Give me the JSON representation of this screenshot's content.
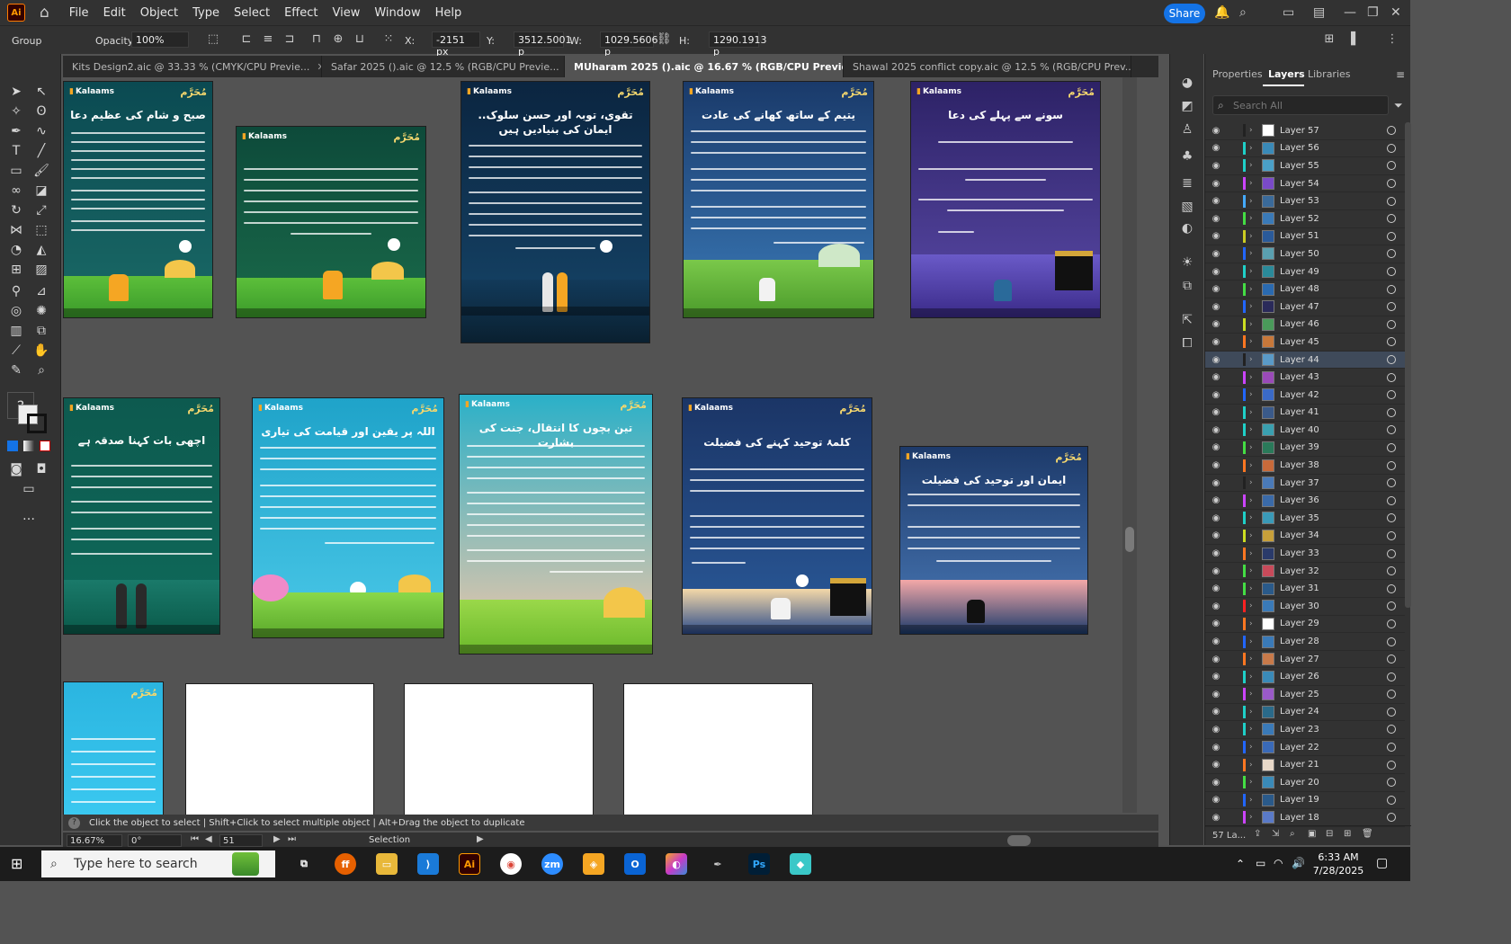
{
  "app": {
    "logo": "Ai",
    "menu": [
      "File",
      "Edit",
      "Object",
      "Type",
      "Select",
      "Effect",
      "View",
      "Window",
      "Help"
    ],
    "share_label": "Share"
  },
  "control_bar": {
    "selection_label": "Group",
    "opacity_label": "Opacity:",
    "opacity_value": "100%",
    "x_label": "X:",
    "x_value": "-2151 px",
    "y_label": "Y:",
    "y_value": "3512.5001 p",
    "w_label": "W:",
    "w_value": "1029.5606 p",
    "h_label": "H:",
    "h_value": "1290.1913 p"
  },
  "tabs": [
    {
      "label": "Kits Design2.aic @ 33.33 % (CMYK/CPU Previe...",
      "active": false
    },
    {
      "label": "Safar 2025 ().aic @ 12.5 % (RGB/CPU Previe...",
      "active": false
    },
    {
      "label": "MUharam 2025 ().aic @ 16.67 % (RGB/CPU Preview)",
      "active": true
    },
    {
      "label": "Shawal 2025 conflict copy.aic @ 12.5 % (RGB/CPU Prev...",
      "active": false
    }
  ],
  "artboard_brand": "Kalaams",
  "artboard_logo": "مُحَرَّم",
  "artboards": [
    {
      "title": "صبح و شام کی عظیم دعا",
      "bg": "#0b4a52"
    },
    {
      "title": "",
      "bg": "#0d5a3f"
    },
    {
      "title": "تقوی، توبہ اور حسن سلوک.. ایمان کی بنیادیں ہیں",
      "bg": "#0f2d4a"
    },
    {
      "title": "یتیم کے ساتھ کھانے کی عادت",
      "bg": "#1c4a7a"
    },
    {
      "title": "سونے سے پہلے کی دعا",
      "bg": "#3b2d7a"
    },
    {
      "title": "اچھی بات کہنا صدقہ ہے",
      "bg": "#0d5a4f"
    },
    {
      "title": "اللہ پر یقین اور قیامت کی تیاری",
      "bg": "#1fa3c9"
    },
    {
      "title": "تین بچوں کا انتقال، جنت کی بشارت",
      "bg": "#33b5c4"
    },
    {
      "title": "کلمۂ توحید کہنے کی فضیلت",
      "bg": "#1b3566"
    },
    {
      "title": "ایمان اور توحید کی فضیلت",
      "bg": "#1d3a6a"
    },
    {
      "title": "",
      "bg": "#2bb5e0"
    }
  ],
  "layers_panel": {
    "tabs": [
      "Properties",
      "Layers",
      "Libraries"
    ],
    "search_placeholder": "Search All",
    "layers": [
      {
        "name": "Layer 57",
        "color": "#222222",
        "thumb": "#ffffff"
      },
      {
        "name": "Layer 56",
        "color": "#1fd0c8",
        "thumb": "#3a8ab8"
      },
      {
        "name": "Layer 55",
        "color": "#1fd0c8",
        "thumb": "#4aa0c8"
      },
      {
        "name": "Layer 54",
        "color": "#cc44ff",
        "thumb": "#7a4ac8"
      },
      {
        "name": "Layer 53",
        "color": "#44aaff",
        "thumb": "#3a6a9a"
      },
      {
        "name": "Layer 52",
        "color": "#44dd44",
        "thumb": "#3a7ab8"
      },
      {
        "name": "Layer 51",
        "color": "#cccc22",
        "thumb": "#2a5a9a"
      },
      {
        "name": "Layer 50",
        "color": "#2266ff",
        "thumb": "#5aa0b0"
      },
      {
        "name": "Layer 49",
        "color": "#1fd0c8",
        "thumb": "#2a8a9a"
      },
      {
        "name": "Layer 48",
        "color": "#44dd44",
        "thumb": "#2a6ab0"
      },
      {
        "name": "Layer 47",
        "color": "#2266ff",
        "thumb": "#2a2a5a"
      },
      {
        "name": "Layer 46",
        "color": "#ccdd22",
        "thumb": "#4a9a5a"
      },
      {
        "name": "Layer 45",
        "color": "#ff7722",
        "thumb": "#c8783a"
      },
      {
        "name": "Layer 44",
        "color": "#222222",
        "thumb": "#5a9ac8",
        "selected": true
      },
      {
        "name": "Layer 43",
        "color": "#cc44ff",
        "thumb": "#9a4ab8"
      },
      {
        "name": "Layer 42",
        "color": "#2266ff",
        "thumb": "#3a6ac8"
      },
      {
        "name": "Layer 41",
        "color": "#1fd0c8",
        "thumb": "#3a5a8a"
      },
      {
        "name": "Layer 40",
        "color": "#1fd0c8",
        "thumb": "#3aa0b0"
      },
      {
        "name": "Layer 39",
        "color": "#44dd44",
        "thumb": "#2a7a5a"
      },
      {
        "name": "Layer 38",
        "color": "#ff7722",
        "thumb": "#c86a3a"
      },
      {
        "name": "Layer 37",
        "color": "#222222",
        "thumb": "#4a7ab8"
      },
      {
        "name": "Layer 36",
        "color": "#cc44ff",
        "thumb": "#3a6aa8"
      },
      {
        "name": "Layer 35",
        "color": "#1fd0c8",
        "thumb": "#3a9ab8"
      },
      {
        "name": "Layer 34",
        "color": "#ccdd22",
        "thumb": "#c8a03a"
      },
      {
        "name": "Layer 33",
        "color": "#ff7722",
        "thumb": "#2a3a6a"
      },
      {
        "name": "Layer 32",
        "color": "#44dd44",
        "thumb": "#c84a5a"
      },
      {
        "name": "Layer 31",
        "color": "#44dd44",
        "thumb": "#2a5a8a"
      },
      {
        "name": "Layer 30",
        "color": "#ff2222",
        "thumb": "#3a7ab8"
      },
      {
        "name": "Layer 29",
        "color": "#ff7722",
        "thumb": "#ffffff"
      },
      {
        "name": "Layer 28",
        "color": "#2266ff",
        "thumb": "#3a7ab8"
      },
      {
        "name": "Layer 27",
        "color": "#ff7722",
        "thumb": "#c87a4a"
      },
      {
        "name": "Layer 26",
        "color": "#1fd0c8",
        "thumb": "#3a8ab8"
      },
      {
        "name": "Layer 25",
        "color": "#cc44ff",
        "thumb": "#9a5ac8"
      },
      {
        "name": "Layer 24",
        "color": "#1fd0c8",
        "thumb": "#2a6a8a"
      },
      {
        "name": "Layer 23",
        "color": "#1fd0c8",
        "thumb": "#3a7ab8"
      },
      {
        "name": "Layer 22",
        "color": "#2266ff",
        "thumb": "#3a6ab8"
      },
      {
        "name": "Layer 21",
        "color": "#ff7722",
        "thumb": "#e8d8c8"
      },
      {
        "name": "Layer 20",
        "color": "#44dd44",
        "thumb": "#3a8ab8"
      },
      {
        "name": "Layer 19",
        "color": "#2266ff",
        "thumb": "#2a5a8a"
      },
      {
        "name": "Layer 18",
        "color": "#cc44ff",
        "thumb": "#5a7ac8"
      }
    ],
    "layer_count": "57 La..."
  },
  "status": {
    "hint": "Click the object to select  |  Shift+Click to select multiple object  |  Alt+Drag the object to duplicate",
    "zoom": "16.67%",
    "rotation": "0°",
    "artboard_number": "51",
    "mode": "Selection"
  },
  "taskbar": {
    "search_placeholder": "Type here to search",
    "time": "6:33 AM",
    "date": "7/28/2025"
  }
}
